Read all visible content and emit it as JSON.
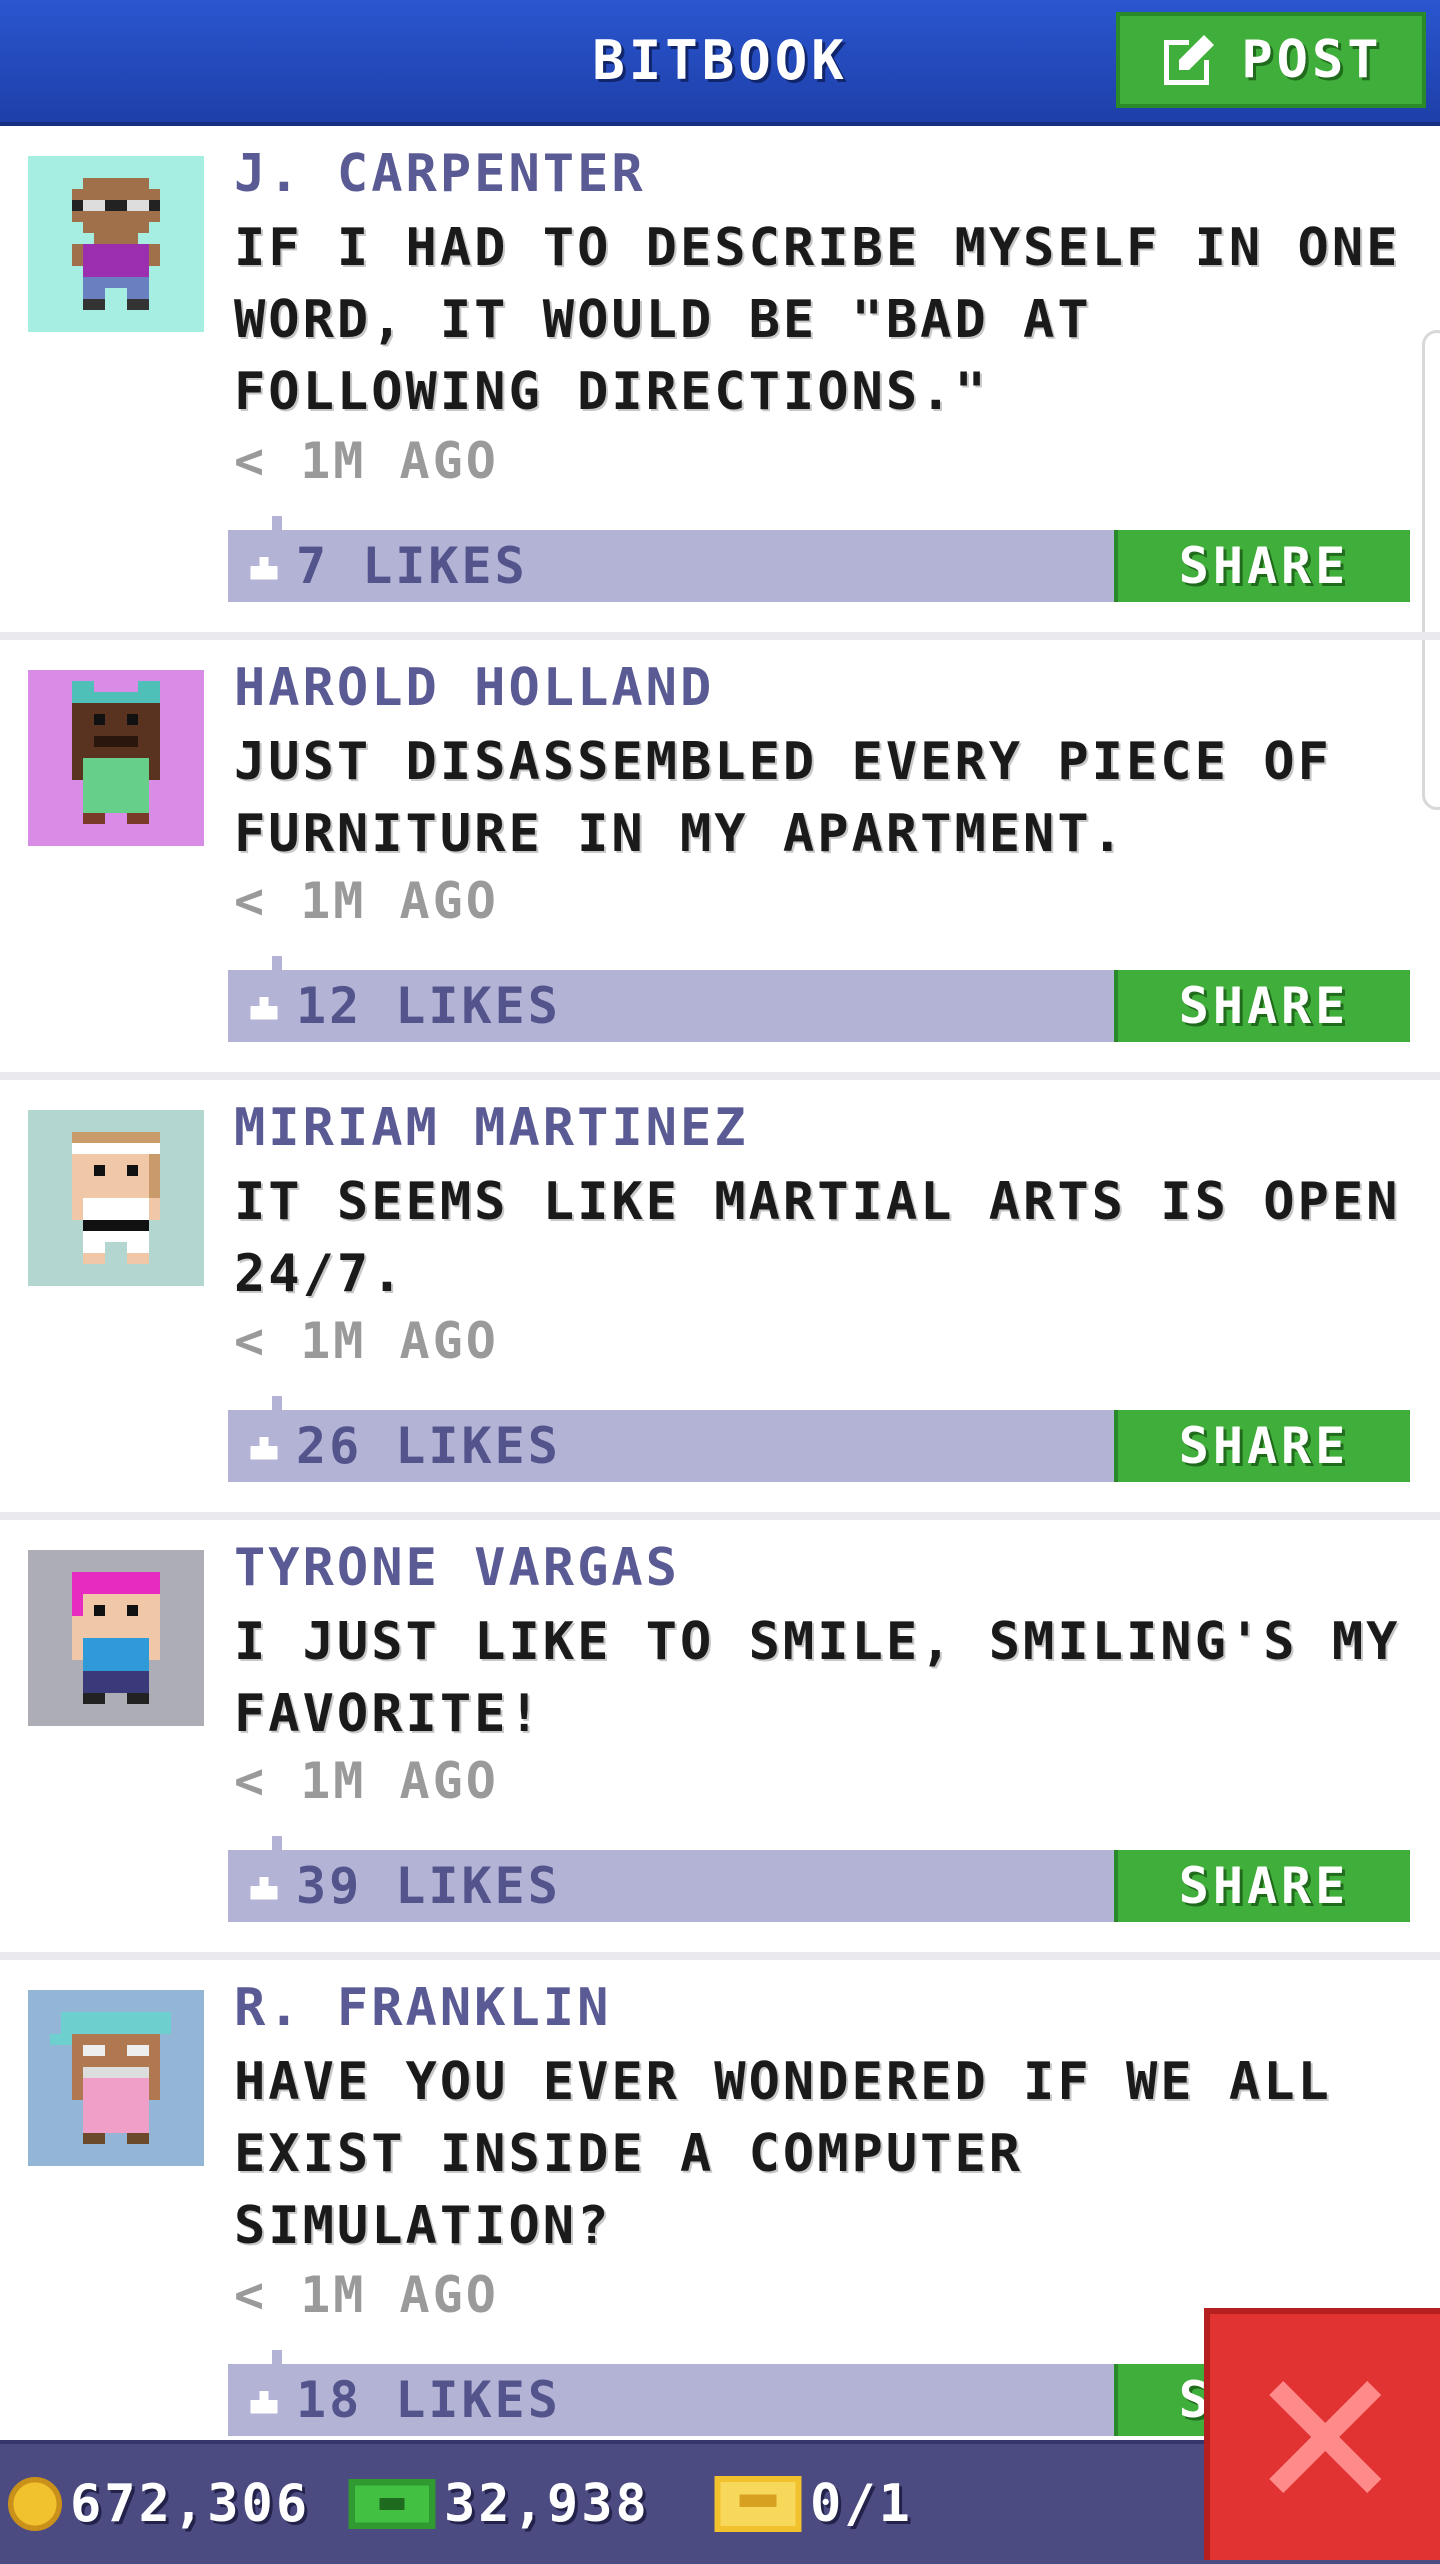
{
  "header": {
    "title": "BITBOOK",
    "post_label": "POST"
  },
  "posts": [
    {
      "author": "J. CARPENTER",
      "message": "IF I HAD TO DESCRIBE MYSELF IN ONE WORD, IT WOULD BE \"BAD AT FOLLOWING DIRECTIONS.\"",
      "time": "< 1M AGO",
      "likes": "7 LIKES",
      "share": "SHARE",
      "avatar_bg": "#a6ede2"
    },
    {
      "author": "HAROLD HOLLAND",
      "message": "JUST DISASSEMBLED EVERY PIECE OF FURNITURE IN MY APARTMENT.",
      "time": "< 1M AGO",
      "likes": "12 LIKES",
      "share": "SHARE",
      "avatar_bg": "#d98ce6"
    },
    {
      "author": "MIRIAM MARTINEZ",
      "message": "IT SEEMS LIKE MARTIAL ARTS IS OPEN 24/7.",
      "time": "< 1M AGO",
      "likes": "26 LIKES",
      "share": "SHARE",
      "avatar_bg": "#b3d6d0"
    },
    {
      "author": "TYRONE VARGAS",
      "message": "I JUST LIKE TO SMILE, SMILING'S MY FAVORITE!",
      "time": "< 1M AGO",
      "likes": "39 LIKES",
      "share": "SHARE",
      "avatar_bg": "#adadb6"
    },
    {
      "author": "R. FRANKLIN",
      "message": "HAVE YOU EVER WONDERED IF WE ALL EXIST INSIDE A COMPUTER SIMULATION?",
      "time": "< 1M AGO",
      "likes": "18 LIKES",
      "share": "SHARE",
      "avatar_bg": "#93b6d6"
    }
  ],
  "bottom_bar": {
    "coins": "672,306",
    "bux": "32,938",
    "tickets": "0/1"
  },
  "colors": {
    "header_blue": "#2a56d0",
    "share_green": "#3fae3a",
    "likes_bar": "#b3b3d6",
    "bottom_bar": "#4b4b82",
    "close_red": "#e23333"
  }
}
